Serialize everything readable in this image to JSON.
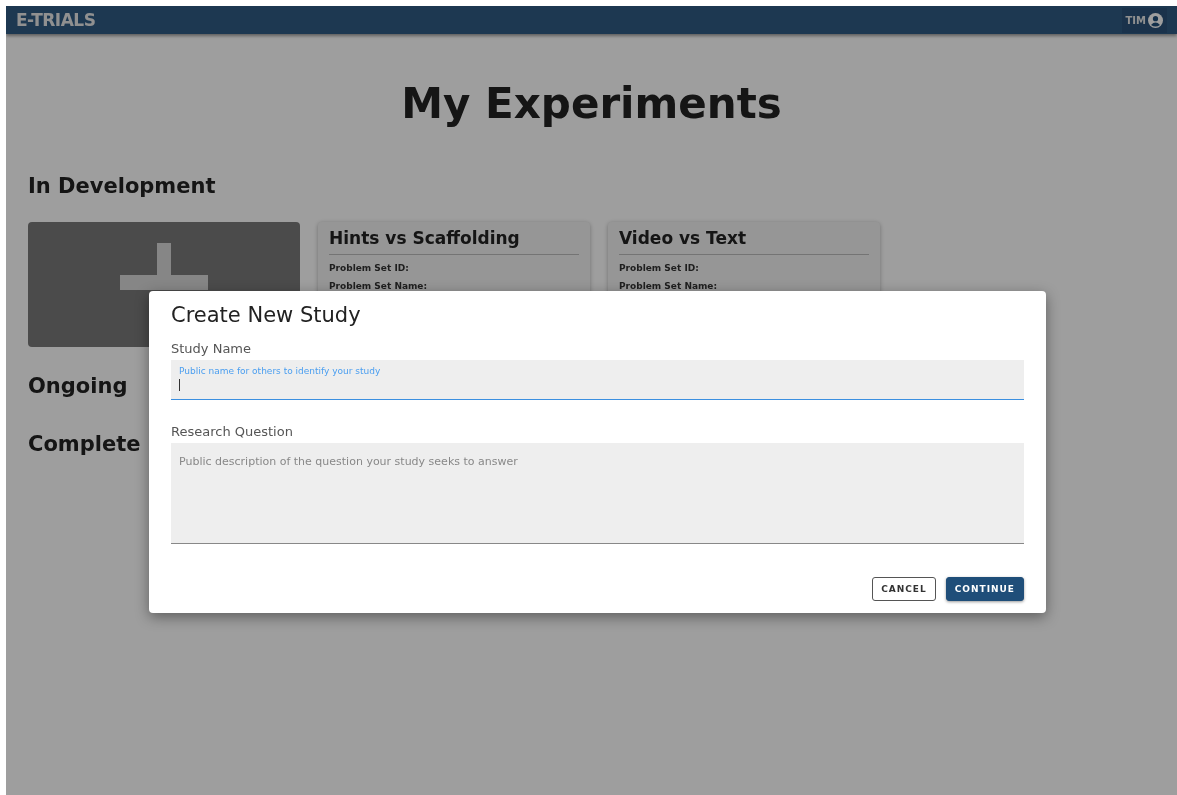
{
  "header": {
    "logo": "E-TRIALS",
    "user": "TIM"
  },
  "page_title": "My Experiments",
  "sections": [
    {
      "title": "In Development",
      "cards": [
        {
          "kind": "create"
        },
        {
          "kind": "study",
          "title": "Hints vs Scaffolding",
          "fields": [
            "Problem Set ID:",
            "Problem Set Name:"
          ]
        },
        {
          "kind": "study",
          "title": "Video vs Text",
          "fields": [
            "Problem Set ID:",
            "Problem Set Name:"
          ]
        }
      ]
    },
    {
      "title": "Ongoing"
    },
    {
      "title": "Complete"
    }
  ],
  "dialog": {
    "title": "Create New Study",
    "fields": [
      {
        "kind": "line",
        "label": "Study Name",
        "floating_label": "Public name for others to identify your study",
        "focused": true
      },
      {
        "kind": "area",
        "label": "Research Question",
        "placeholder": "Public description of the question your study seeks to answer",
        "focused": false
      }
    ],
    "buttons": [
      {
        "label": "CANCEL",
        "primary": false
      },
      {
        "label": "CONTINUE",
        "primary": true
      }
    ]
  }
}
